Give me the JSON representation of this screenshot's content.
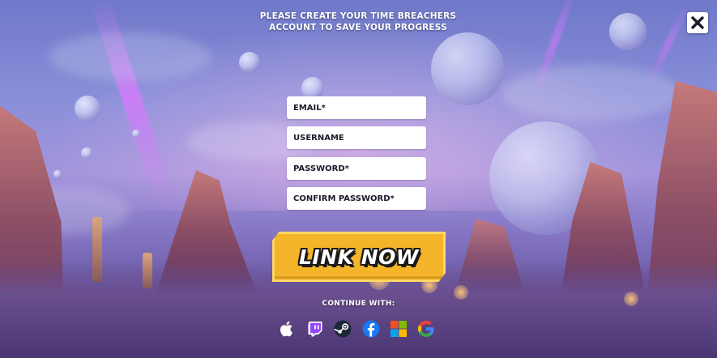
{
  "header": {
    "title_line1": "PLEASE CREATE YOUR TIME BREACHERS",
    "title_line2": "ACCOUNT TO SAVE YOUR PROGRESS"
  },
  "form": {
    "email_placeholder": "EMAIL*",
    "username_placeholder": "USERNAME",
    "password_placeholder": "PASSWORD*",
    "confirm_password_placeholder": "CONFIRM PASSWORD*",
    "submit_label": "LINK NOW"
  },
  "social": {
    "label": "CONTINUE WITH:",
    "providers": [
      "apple-icon",
      "twitch-icon",
      "steam-icon",
      "facebook-icon",
      "microsoft-icon",
      "google-icon"
    ]
  },
  "colors": {
    "button_fill": "#f5b52a",
    "button_text": "#ffffff",
    "field_bg": "#ffffff"
  }
}
